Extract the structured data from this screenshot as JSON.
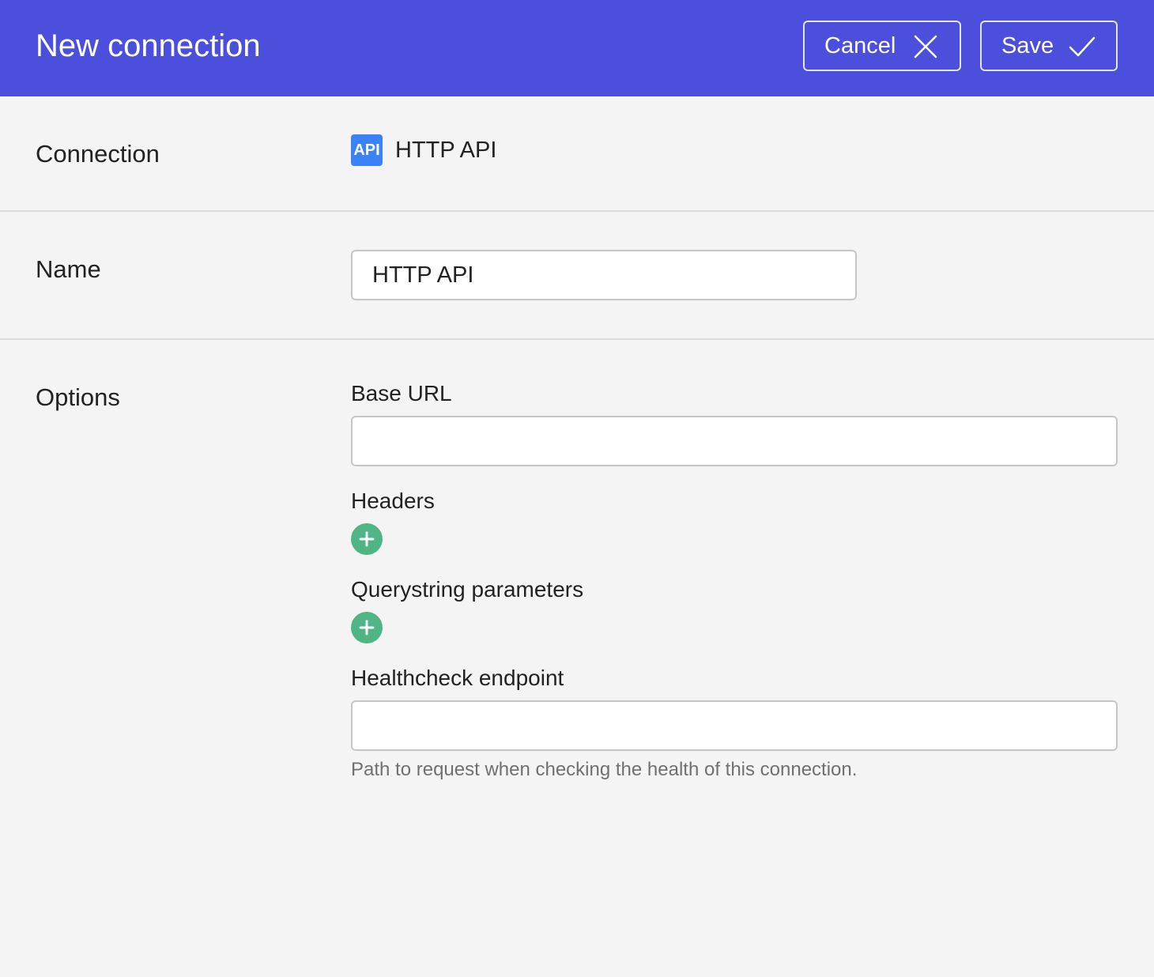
{
  "header": {
    "title": "New connection",
    "cancel_label": "Cancel",
    "save_label": "Save",
    "cancel_icon": "close-icon",
    "save_icon": "check-icon",
    "background_color": "#4b4fdc"
  },
  "connection": {
    "label": "Connection",
    "badge_text": "API",
    "type_name": "HTTP API",
    "badge_color": "#3b82f6"
  },
  "name": {
    "label": "Name",
    "value": "HTTP API"
  },
  "options": {
    "label": "Options",
    "base_url": {
      "label": "Base URL",
      "value": ""
    },
    "headers": {
      "label": "Headers",
      "add_icon": "plus-icon"
    },
    "querystring": {
      "label": "Querystring parameters",
      "add_icon": "plus-icon"
    },
    "healthcheck": {
      "label": "Healthcheck endpoint",
      "value": "",
      "help": "Path to request when checking the health of this connection."
    },
    "add_button_color": "#4fb584"
  }
}
